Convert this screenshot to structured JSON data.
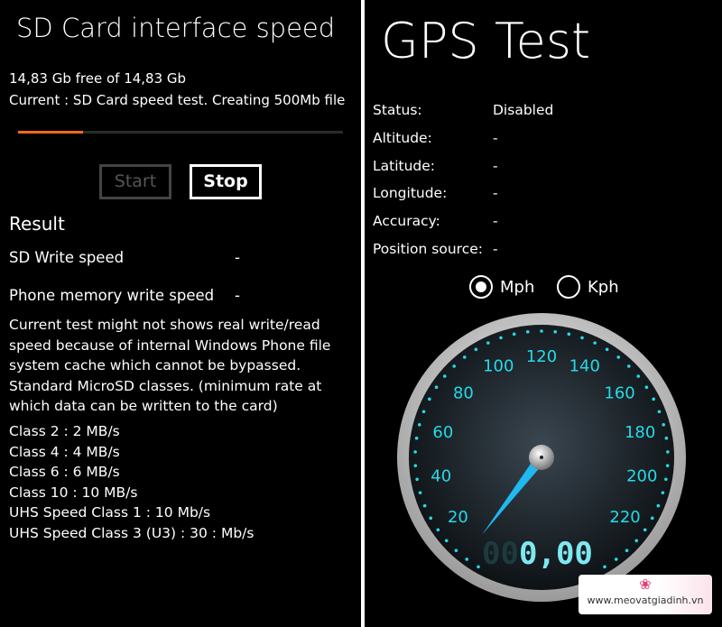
{
  "sd": {
    "title": "SD Card interface speed",
    "free": "14,83 Gb free of 14,83 Gb",
    "current": "Current : SD Card speed test. Creating 500Mb file",
    "progress_percent": 20,
    "start_label": "Start",
    "stop_label": "Stop",
    "result_heading": "Result",
    "rows": [
      {
        "label": "SD Write speed",
        "value": "-"
      },
      {
        "label": "Phone memory write speed",
        "value": "-"
      }
    ],
    "note": "Current test might not shows real write/read speed because of internal Windows Phone file system cache which cannot be bypassed. Standard MicroSD classes. (minimum rate at which data can be written to the card)",
    "classes": [
      "Class 2 : 2 MB/s",
      "Class 4 : 4 MB/s",
      "Class 6 : 6 MB/s",
      "Class 10 : 10 MB/s",
      "UHS Speed Class 1 : 10 Mb/s",
      "UHS Speed Class 3 (U3) : 30 : Mb/s"
    ],
    "accent": "#f26b1a"
  },
  "gps": {
    "title": "GPS Test",
    "fields": [
      {
        "label": "Status:",
        "value": "Disabled"
      },
      {
        "label": "Altitude:",
        "value": "-"
      },
      {
        "label": "Latitude:",
        "value": "-"
      },
      {
        "label": "Longitude:",
        "value": "-"
      },
      {
        "label": "Accuracy:",
        "value": "-"
      },
      {
        "label": "Position source:",
        "value": "-"
      }
    ],
    "units": {
      "mph": "Mph",
      "kph": "Kph",
      "selected": "Mph"
    },
    "gauge": {
      "labels": [
        "20",
        "40",
        "60",
        "80",
        "100",
        "120",
        "140",
        "160",
        "180",
        "200",
        "220"
      ],
      "speed": 0,
      "readout_dim": "00",
      "readout": "0,00",
      "color": "#26d9e8"
    },
    "watermark": "www.meovatgiadinh.vn"
  }
}
